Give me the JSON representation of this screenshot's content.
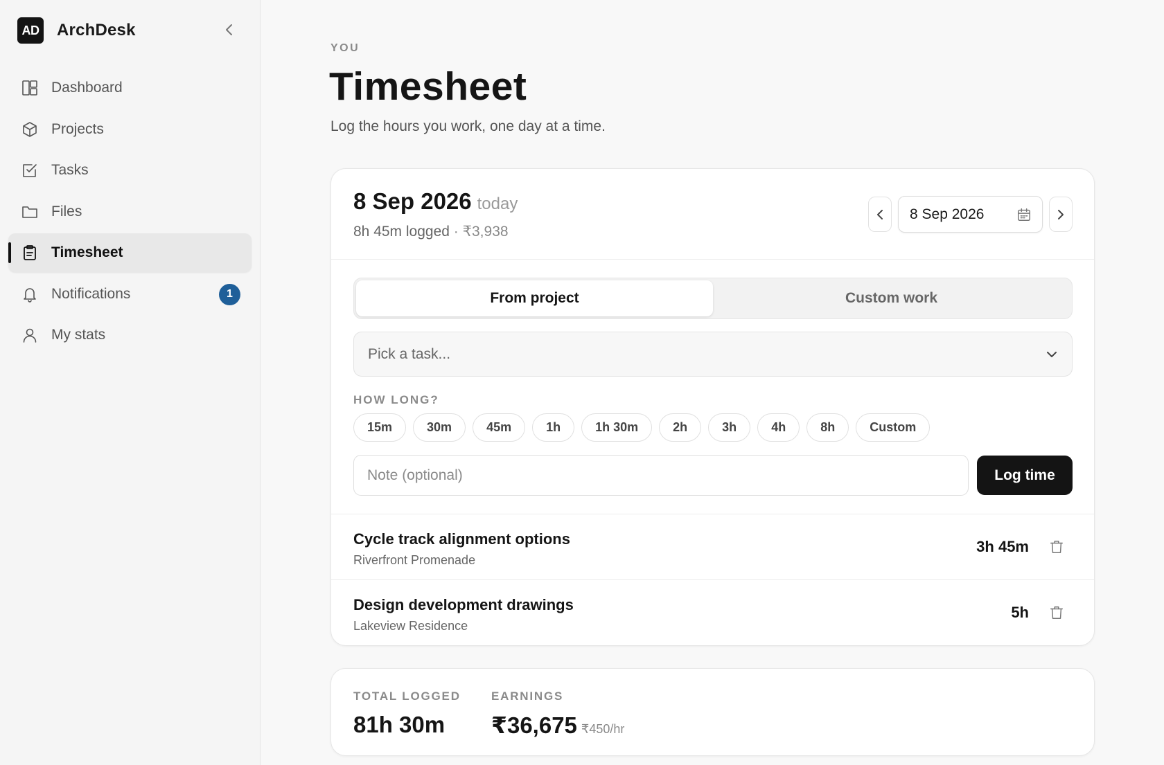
{
  "app": {
    "logo_text": "AD",
    "name": "ArchDesk"
  },
  "sidebar": {
    "items": [
      {
        "label": "Dashboard",
        "icon": "dashboard-icon"
      },
      {
        "label": "Projects",
        "icon": "box-icon"
      },
      {
        "label": "Tasks",
        "icon": "checkbox-icon"
      },
      {
        "label": "Files",
        "icon": "folder-icon"
      },
      {
        "label": "Timesheet",
        "icon": "clipboard-icon",
        "active": true
      },
      {
        "label": "Notifications",
        "icon": "bell-icon",
        "badge": "1"
      },
      {
        "label": "My stats",
        "icon": "user-icon"
      }
    ]
  },
  "header": {
    "eyebrow": "YOU",
    "title": "Timesheet",
    "subtitle": "Log the hours you work, one day at a time."
  },
  "day": {
    "date": "8 Sep 2026",
    "relative": "today",
    "logged": "8h 45m logged",
    "separator": "·",
    "amount": "₹3,938",
    "picker_value": "8 Sep 2026"
  },
  "mode": {
    "tabs": [
      "From project",
      "Custom work"
    ],
    "active": "From project"
  },
  "task_select": {
    "placeholder": "Pick a task..."
  },
  "duration": {
    "label": "HOW LONG?",
    "options": [
      "15m",
      "30m",
      "45m",
      "1h",
      "1h 30m",
      "2h",
      "3h",
      "4h",
      "8h",
      "Custom"
    ]
  },
  "note": {
    "placeholder": "Note (optional)",
    "value": ""
  },
  "log_button": "Log time",
  "entries": [
    {
      "title": "Cycle track alignment options",
      "project": "Riverfront Promenade",
      "duration": "3h 45m"
    },
    {
      "title": "Design development drawings",
      "project": "Lakeview Residence",
      "duration": "5h"
    }
  ],
  "stats": {
    "total_label": "TOTAL LOGGED",
    "total_value": "81h 30m",
    "earnings_label": "EARNINGS",
    "earnings_value": "₹36,675",
    "rate": "₹450/hr"
  },
  "colors": {
    "accent_dark": "#141414",
    "badge": "#1f5f99",
    "background": "#f8f8f8"
  }
}
